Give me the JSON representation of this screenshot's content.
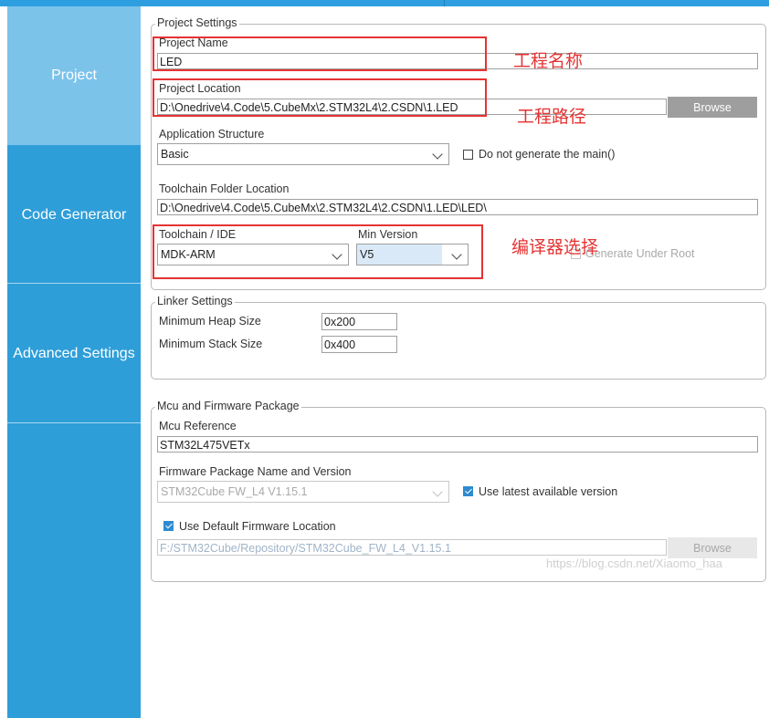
{
  "sidebar": {
    "items": [
      {
        "label": "Project",
        "active": true
      },
      {
        "label": "Code Generator",
        "active": false
      },
      {
        "label": "Advanced Settings",
        "active": false
      }
    ]
  },
  "project_settings": {
    "legend": "Project Settings",
    "project_name_label": "Project Name",
    "project_name_value": "LED",
    "project_location_label": "Project Location",
    "project_location_value": "D:\\Onedrive\\4.Code\\5.CubeMx\\2.STM32L4\\2.CSDN\\1.LED",
    "browse_label": "Browse",
    "app_structure_label": "Application Structure",
    "app_structure_value": "Basic",
    "no_main_label": "Do not generate the main()",
    "toolchain_folder_label": "Toolchain Folder Location",
    "toolchain_folder_value": "D:\\Onedrive\\4.Code\\5.CubeMx\\2.STM32L4\\2.CSDN\\1.LED\\LED\\",
    "toolchain_label": "Toolchain / IDE",
    "toolchain_value": "MDK-ARM",
    "min_version_label": "Min Version",
    "min_version_value": "V5",
    "generate_root_label": "Generate Under Root"
  },
  "linker_settings": {
    "legend": "Linker Settings",
    "heap_label": "Minimum Heap Size",
    "heap_value": "0x200",
    "stack_label": "Minimum Stack Size",
    "stack_value": "0x400"
  },
  "mcu_firmware": {
    "legend": "Mcu and Firmware Package",
    "mcu_ref_label": "Mcu Reference",
    "mcu_ref_value": "STM32L475VETx",
    "fw_pkg_label": "Firmware Package Name and Version",
    "fw_pkg_value": "STM32Cube FW_L4 V1.15.1",
    "use_latest_label": "Use latest available version",
    "use_default_loc_label": "Use Default Firmware Location",
    "fw_location_value": "F:/STM32Cube/Repository/STM32Cube_FW_L4_V1.15.1",
    "browse_label": "Browse"
  },
  "annotations": {
    "project_name": "工程名称",
    "project_path": "工程路径",
    "compiler": "编译器选择"
  },
  "watermark": "https://blog.csdn.net/Xiaomo_haa",
  "colors": {
    "accent": "#2e9ed9",
    "sidebar_active": "#7cc3ea",
    "annotation_red": "#e53333",
    "button_gray": "#9e9e9e"
  }
}
